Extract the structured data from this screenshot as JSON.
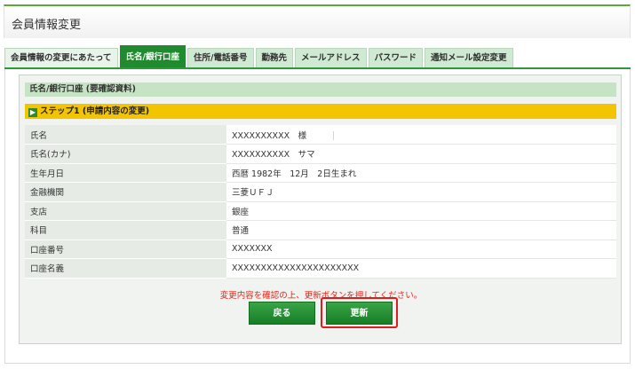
{
  "page": {
    "title": "会員情報変更"
  },
  "tabs": [
    {
      "label": "会員情報の変更にあたって",
      "active": false
    },
    {
      "label": "氏名/銀行口座",
      "active": true
    },
    {
      "label": "住所/電話番号",
      "active": false
    },
    {
      "label": "勤務先",
      "active": false
    },
    {
      "label": "メールアドレス",
      "active": false
    },
    {
      "label": "パスワード",
      "active": false
    },
    {
      "label": "通知メール設定変更",
      "active": false
    }
  ],
  "section": {
    "title": "氏名/銀行口座 (要確認資料)"
  },
  "step": {
    "icon": "arrow-right-icon",
    "label": "ステップ1 (申請内容の変更)"
  },
  "rows": [
    {
      "label": "氏名",
      "value": "XXXXXXXXXX　様"
    },
    {
      "label": "氏名(カナ)",
      "value": "XXXXXXXXXX　サマ"
    },
    {
      "label": "生年月日",
      "value": "西暦 1982年　12月　2日生まれ"
    },
    {
      "label": "金融機関",
      "value": "三菱ＵＦＪ"
    },
    {
      "label": "支店",
      "value": "銀座"
    },
    {
      "label": "科目",
      "value": "普通"
    },
    {
      "label": "口座番号",
      "value": "XXXXXXX"
    },
    {
      "label": "口座名義",
      "value": "XXXXXXXXXXXXXXXXXXXXXX"
    }
  ],
  "notice": "変更内容を確認の上、更新ボタンを押してください。",
  "buttons": {
    "back": "戻る",
    "update": "更新"
  },
  "colors": {
    "accent": "#1f8a2e",
    "step_bar": "#f3c400",
    "notice": "#e8241c",
    "highlight": "#e01c1c"
  }
}
